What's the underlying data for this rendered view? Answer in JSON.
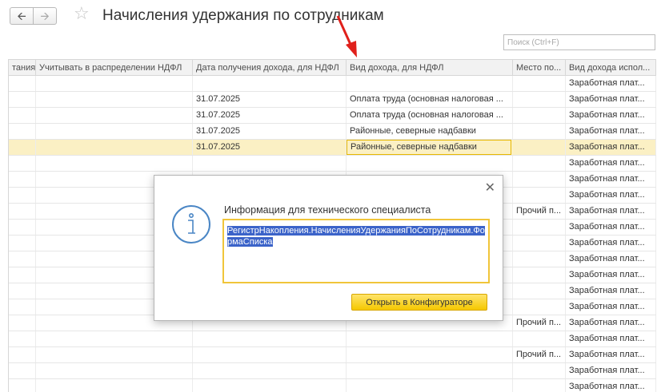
{
  "header": {
    "title": "Начисления удержания по сотрудникам",
    "search_placeholder": "Поиск (Ctrl+F)"
  },
  "table": {
    "columns": [
      "тания",
      "Учитывать в распределении НДФЛ",
      "Дата получения дохода, для НДФЛ",
      "Вид дохода, для НДФЛ",
      "Место по...",
      "Вид дохода испол..."
    ],
    "rows": [
      {
        "date": "",
        "kind": "",
        "place": "",
        "income": "Заработная плат..."
      },
      {
        "date": "31.07.2025",
        "kind": "Оплата труда (основная налоговая ...",
        "place": "",
        "income": "Заработная плат..."
      },
      {
        "date": "31.07.2025",
        "kind": "Оплата труда (основная налоговая ...",
        "place": "",
        "income": "Заработная плат..."
      },
      {
        "date": "31.07.2025",
        "kind": "Районные, северные надбавки",
        "place": "",
        "income": "Заработная плат..."
      },
      {
        "date": "31.07.2025",
        "kind": "Районные, северные надбавки",
        "place": "",
        "income": "Заработная плат..."
      },
      {
        "date": "",
        "kind": "",
        "place": "",
        "income": "Заработная плат..."
      },
      {
        "date": "",
        "kind": "",
        "place": "",
        "income": "Заработная плат..."
      },
      {
        "date": "",
        "kind": "",
        "place": "",
        "income": "Заработная плат..."
      },
      {
        "date": "",
        "kind": "",
        "place": "Прочий п...",
        "income": "Заработная плат..."
      },
      {
        "date": "",
        "kind": "",
        "place": "",
        "income": "Заработная плат..."
      },
      {
        "date": "",
        "kind": "",
        "place": "",
        "income": "Заработная плат..."
      },
      {
        "date": "",
        "kind": "",
        "place": "",
        "income": "Заработная плат..."
      },
      {
        "date": "",
        "kind": "",
        "place": "",
        "income": "Заработная плат..."
      },
      {
        "date": "",
        "kind": "",
        "place": "",
        "income": "Заработная плат..."
      },
      {
        "date": "",
        "kind": "",
        "place": "",
        "income": "Заработная плат..."
      },
      {
        "date": "",
        "kind": "",
        "place": "Прочий п...",
        "income": "Заработная плат..."
      },
      {
        "date": "",
        "kind": "",
        "place": "",
        "income": "Заработная плат..."
      },
      {
        "date": "",
        "kind": "",
        "place": "Прочий п...",
        "income": "Заработная плат..."
      },
      {
        "date": "",
        "kind": "",
        "place": "",
        "income": "Заработная плат..."
      },
      {
        "date": "",
        "kind": "",
        "place": "",
        "income": "Заработная плат..."
      }
    ],
    "selected_row": 4
  },
  "dialog": {
    "title": "Информация для технического специалиста",
    "text": "РегистрНакопления.НачисленияУдержанияПоСотрудникам.ФормаСписка",
    "button_label": "Открыть в Конфигураторе"
  },
  "colors": {
    "accent_yellow": "#f5c800",
    "selected_row": "#fbf0c4",
    "arrow_red": "#e0201b",
    "selection_blue": "#3b63c9"
  }
}
